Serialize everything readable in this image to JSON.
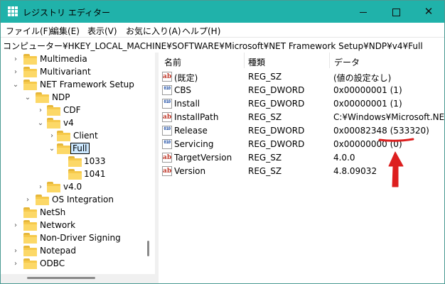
{
  "window": {
    "title": "レジストリ エディター",
    "minimize_glyph": "",
    "maximize_glyph": "",
    "close_glyph": "✕"
  },
  "menu": [
    "ファイル(F)",
    "編集(E)",
    "表示(V)",
    "お気に入り(A)",
    "ヘルプ(H)"
  ],
  "address": "コンピューター¥HKEY_LOCAL_MACHINE¥SOFTWARE¥Microsoft¥NET Framework Setup¥NDP¥v4¥Full",
  "tree": [
    {
      "label": "Multimedia",
      "chevron": "›"
    },
    {
      "label": "Multivariant",
      "chevron": "›"
    },
    {
      "label": "NET Framework Setup",
      "chevron": "⌄"
    },
    {
      "label": "NDP",
      "chevron": "⌄"
    },
    {
      "label": "CDF",
      "chevron": "›"
    },
    {
      "label": "v4",
      "chevron": "⌄"
    },
    {
      "label": "Client",
      "chevron": "›"
    },
    {
      "label": "Full",
      "chevron": "⌄",
      "selected": true
    },
    {
      "label": "1033",
      "chevron": ""
    },
    {
      "label": "1041",
      "chevron": ""
    },
    {
      "label": "v4.0",
      "chevron": "›"
    },
    {
      "label": "OS Integration",
      "chevron": "›"
    },
    {
      "label": "NetSh",
      "chevron": ""
    },
    {
      "label": "Network",
      "chevron": "›"
    },
    {
      "label": "Non-Driver Signing",
      "chevron": ""
    },
    {
      "label": "Notepad",
      "chevron": "›"
    },
    {
      "label": "ODBC",
      "chevron": "›"
    }
  ],
  "list": {
    "headers": [
      "名前",
      "種類",
      "データ"
    ],
    "rows": [
      {
        "icon": "ab",
        "name": "(既定)",
        "type": "REG_SZ",
        "data": "(値の設定なし)"
      },
      {
        "icon": "010",
        "name": "CBS",
        "type": "REG_DWORD",
        "data": "0x00000001 (1)"
      },
      {
        "icon": "010",
        "name": "Install",
        "type": "REG_DWORD",
        "data": "0x00000001 (1)"
      },
      {
        "icon": "ab",
        "name": "InstallPath",
        "type": "REG_SZ",
        "data": "C:¥Windows¥Microsoft.NET¥F"
      },
      {
        "icon": "010",
        "name": "Release",
        "type": "REG_DWORD",
        "data": "0x00082348 (533320)"
      },
      {
        "icon": "010",
        "name": "Servicing",
        "type": "REG_DWORD",
        "data": "0x00000000 (0)"
      },
      {
        "icon": "ab",
        "name": "TargetVersion",
        "type": "REG_SZ",
        "data": "4.0.0"
      },
      {
        "icon": "ab",
        "name": "Version",
        "type": "REG_SZ",
        "data": "4.8.09032"
      }
    ]
  },
  "annotation": {
    "color": "#dd1f1f"
  }
}
